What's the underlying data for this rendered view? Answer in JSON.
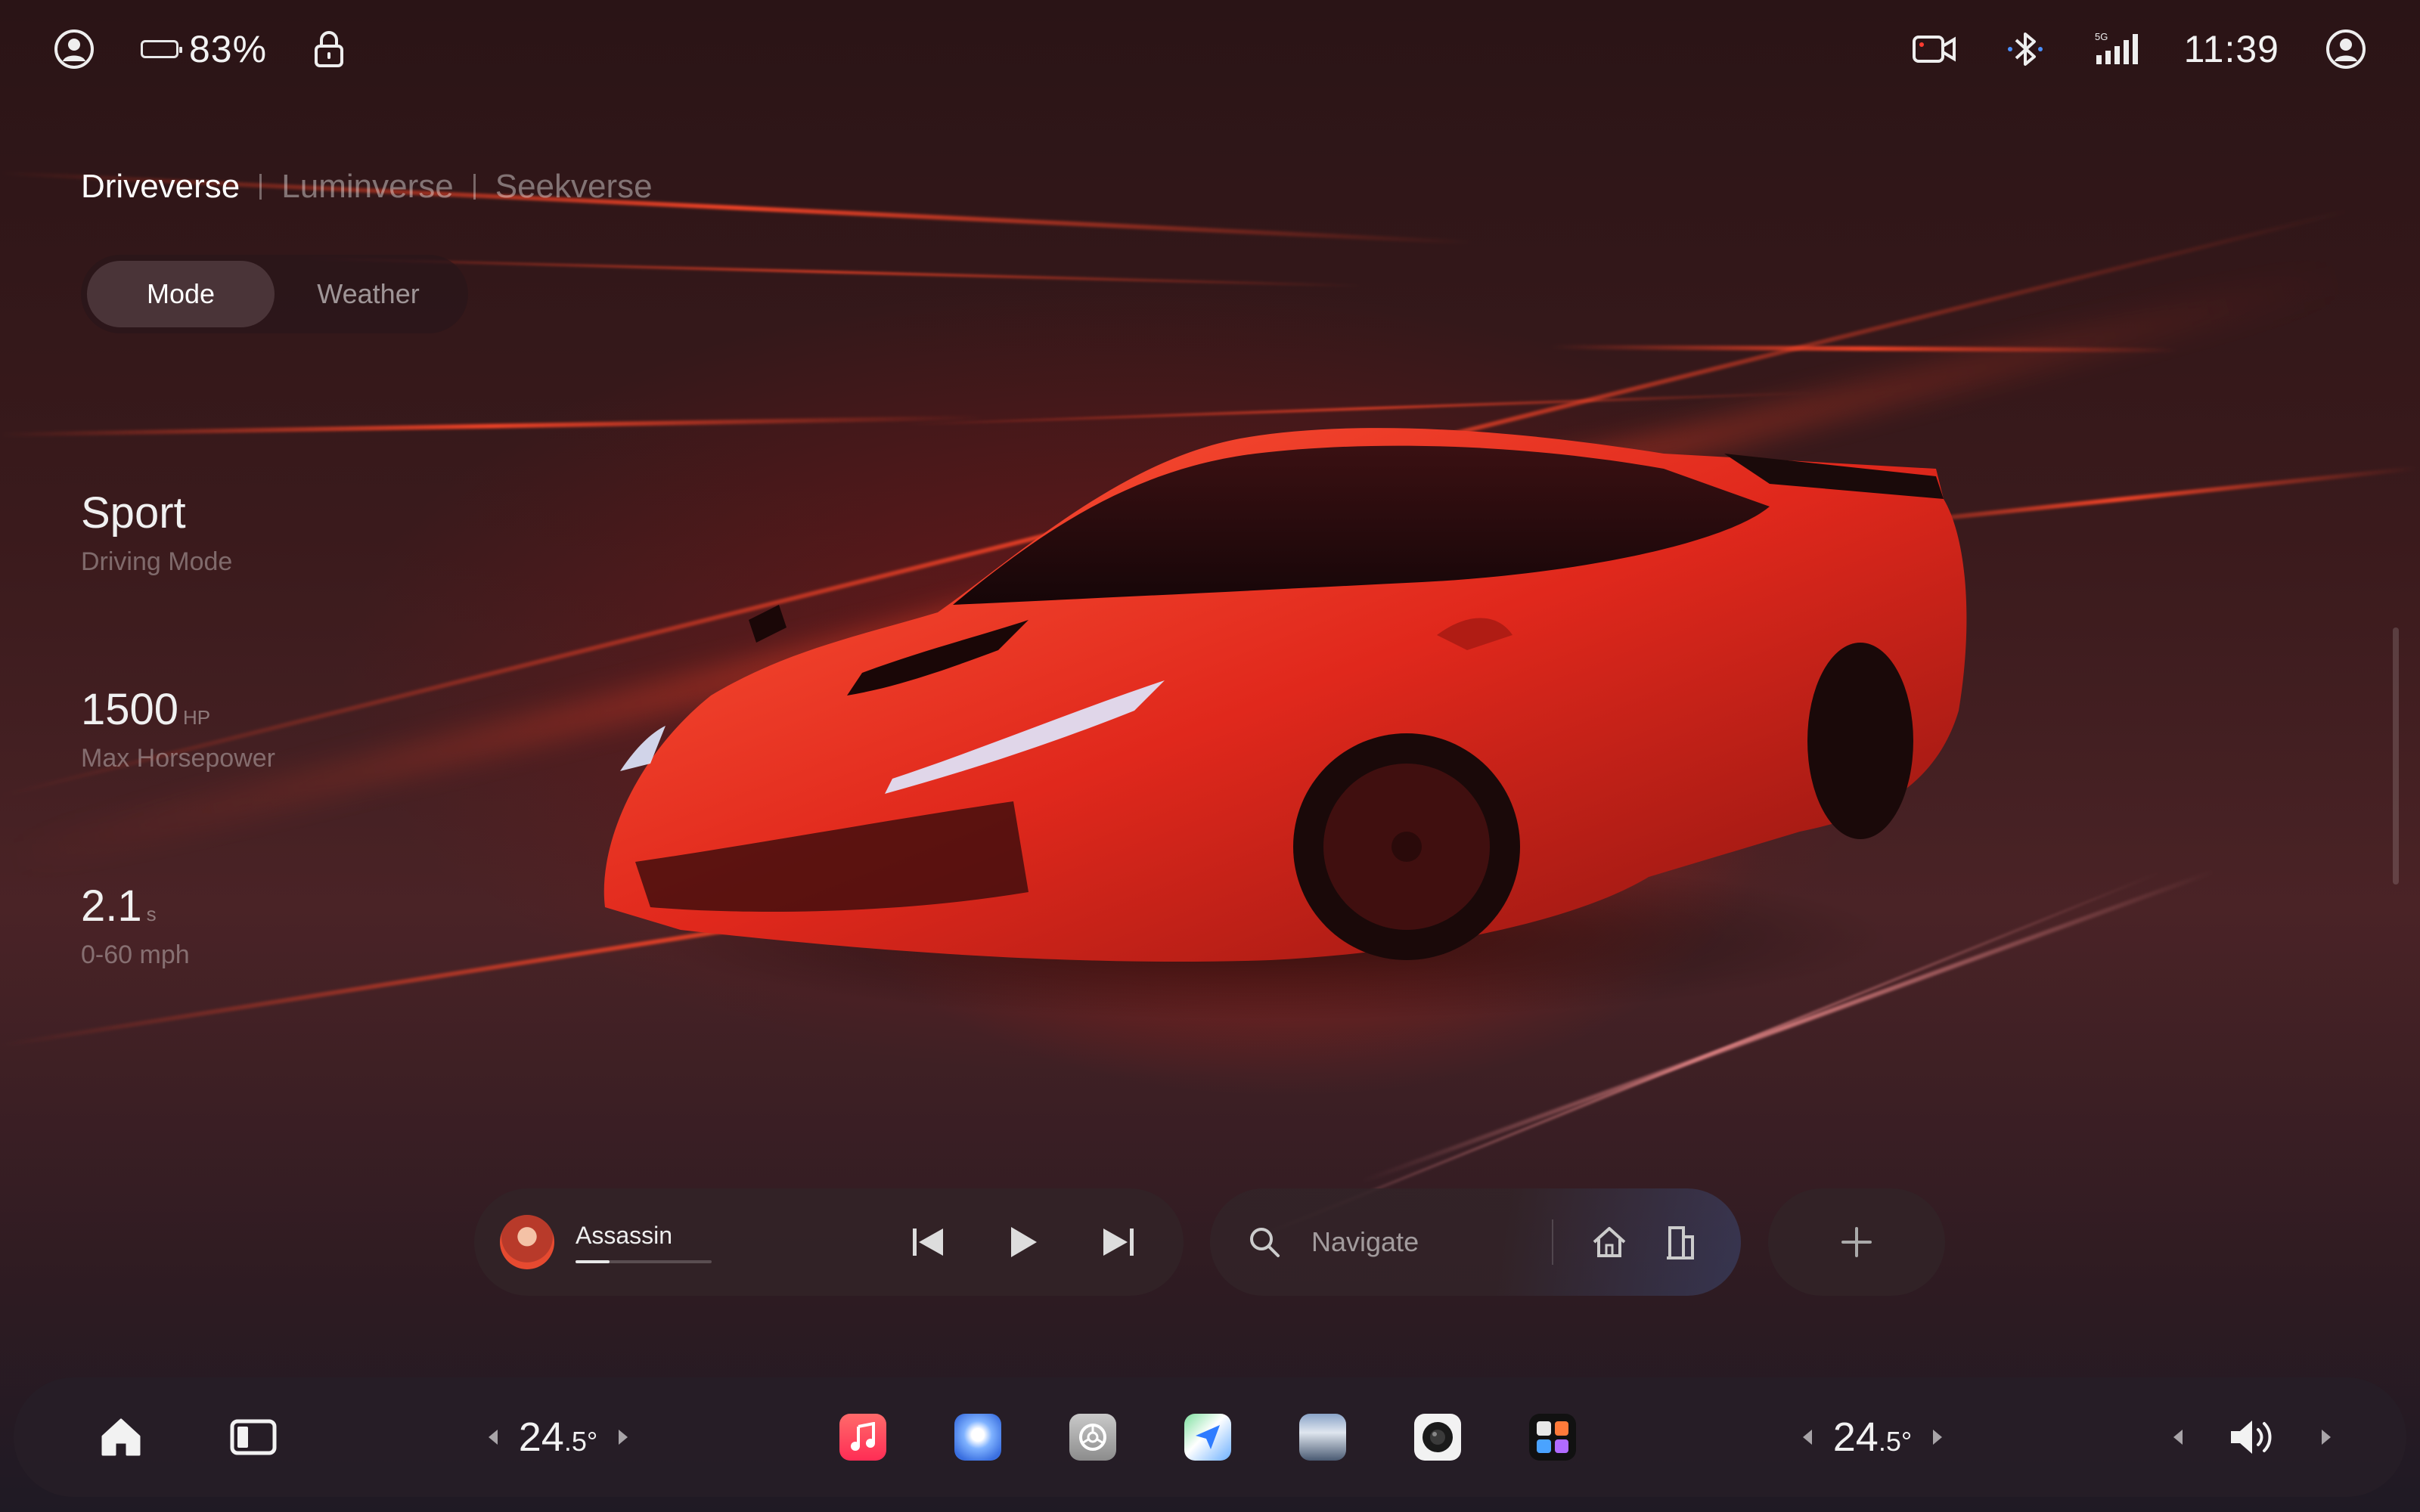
{
  "status_bar": {
    "battery_percent": "83%",
    "battery_level": 0.83,
    "time": "11:39",
    "signal_label": "5G",
    "icons": [
      "profile-icon",
      "battery-icon",
      "lock-icon",
      "camera-icon",
      "bluetooth-icon",
      "signal-icon",
      "account-icon"
    ]
  },
  "verse_tabs": [
    {
      "label": "Driveverse",
      "active": true
    },
    {
      "label": "Luminverse",
      "active": false
    },
    {
      "label": "Seekverse",
      "active": false
    }
  ],
  "segmented": [
    {
      "label": "Mode",
      "active": true
    },
    {
      "label": "Weather",
      "active": false
    }
  ],
  "stats": [
    {
      "value": "Sport",
      "unit": "",
      "label": "Driving Mode"
    },
    {
      "value": "1500",
      "unit": "HP",
      "label": "Max Horsepower"
    },
    {
      "value": "2.1",
      "unit": "s",
      "label": "0-60 mph"
    }
  ],
  "media": {
    "title": "Assassin",
    "progress": 0.25
  },
  "navigation": {
    "placeholder": "Navigate"
  },
  "dock": {
    "left_temp": {
      "whole": "24",
      "decimal": ".5°"
    },
    "right_temp": {
      "whole": "24",
      "decimal": ".5°"
    },
    "apps": [
      "music-app-icon",
      "weather-app-icon",
      "settings-app-icon",
      "maps-app-icon",
      "gallery-app-icon",
      "camera-app-icon",
      "apps-grid-icon"
    ]
  },
  "colors": {
    "accent_red": "#ff3a24",
    "battery_green": "#3ddc4c",
    "dock_bg": "#261e26"
  }
}
